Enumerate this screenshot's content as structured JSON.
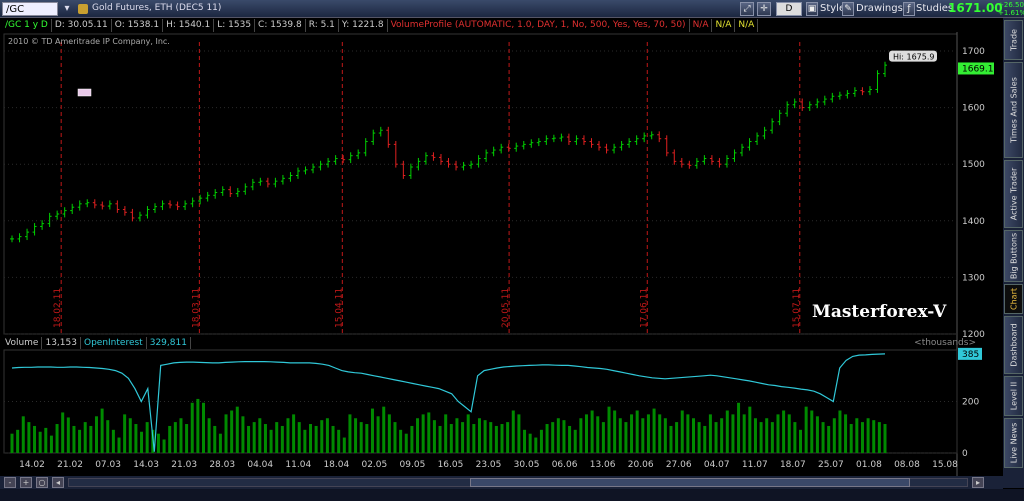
{
  "titlebar": {
    "symbol": "/GC",
    "description": "Gold Futures, ETH (DEC5 11)",
    "period_btn": "D",
    "style_label": "Style",
    "drawings_label": "Drawings",
    "studies_label": "Studies",
    "last_price": "1671.00",
    "net_change": "+26.50",
    "pct_change": "+1.61%"
  },
  "infobar": {
    "sym_period": "/GC 1 y D",
    "date": "D: 30.05.11",
    "open": "O: 1538.1",
    "high": "H: 1540.1",
    "low": "L: 1535",
    "close": "C: 1539.8",
    "range": "R: 5.1",
    "y": "Y: 1221.8",
    "study": "VolumeProfile (AUTOMATIC, 1.0, DAY, 1, No, 500, Yes, Yes, 70, 50)",
    "na1": "N/A",
    "na2": "N/A",
    "na3": "N/A"
  },
  "copyright": "2010 © TD Ameritrade IP Company, Inc.",
  "watermark": "Masterforex-V",
  "price_axis": {
    "ticks": [
      "1700",
      "1600",
      "1500",
      "1400",
      "1300",
      "1200"
    ],
    "last_label": "1669.1",
    "hi_label": "Hi: 1675.9"
  },
  "vertical_markers": [
    "18.02.11",
    "18.03.11",
    "15.04.11",
    "20.05.11",
    "17.06.11",
    "15.07.11"
  ],
  "lower_panel": {
    "volume_label": "Volume",
    "volume_value": "13,153",
    "oi_label": "OpenInterest",
    "oi_value": "329,811",
    "units": "<thousands>",
    "axis_ticks": [
      "200",
      "0"
    ],
    "oi_last": "385"
  },
  "x_axis_dates": [
    "14.02",
    "21.02",
    "07.03",
    "14.03",
    "21.03",
    "28.03",
    "04.04",
    "11.04",
    "18.04",
    "02.05",
    "09.05",
    "16.05",
    "23.05",
    "30.05",
    "06.06",
    "13.06",
    "20.06",
    "27.06",
    "04.07",
    "11.07",
    "18.07",
    "25.07",
    "01.08",
    "08.08",
    "15.08"
  ],
  "side_tabs": [
    "Trade",
    "Times And Sales",
    "Active Trader",
    "Big Buttons",
    "Chart",
    "Dashboard",
    "Level II",
    "Live News"
  ],
  "colors": {
    "up_bar": "#00d000",
    "down_bar": "#e02020",
    "volume": "#008a00",
    "open_interest": "#30c8d8",
    "marker": "#c01818",
    "last_price": "#33ee33"
  },
  "chart_data": {
    "type": "line",
    "title": "",
    "price_ylim": [
      1200,
      1730
    ],
    "closes": [
      1368,
      1372,
      1380,
      1390,
      1395,
      1408,
      1412,
      1418,
      1424,
      1430,
      1432,
      1428,
      1426,
      1430,
      1420,
      1415,
      1405,
      1410,
      1420,
      1425,
      1430,
      1428,
      1425,
      1430,
      1435,
      1440,
      1445,
      1450,
      1455,
      1448,
      1452,
      1460,
      1468,
      1470,
      1465,
      1470,
      1475,
      1480,
      1488,
      1490,
      1495,
      1500,
      1505,
      1510,
      1508,
      1515,
      1520,
      1540,
      1555,
      1560,
      1535,
      1500,
      1480,
      1495,
      1505,
      1515,
      1512,
      1505,
      1500,
      1495,
      1498,
      1500,
      1510,
      1520,
      1525,
      1530,
      1528,
      1532,
      1535,
      1538,
      1540,
      1545,
      1546,
      1548,
      1540,
      1545,
      1540,
      1535,
      1530,
      1525,
      1530,
      1535,
      1540,
      1545,
      1550,
      1552,
      1545,
      1520,
      1505,
      1500,
      1498,
      1505,
      1510,
      1505,
      1500,
      1510,
      1520,
      1530,
      1540,
      1550,
      1560,
      1575,
      1590,
      1605,
      1610,
      1600,
      1605,
      1610,
      1615,
      1620,
      1622,
      1625,
      1630,
      1628,
      1632,
      1660,
      1675
    ],
    "open_interest": [
      330,
      332,
      333,
      333,
      334,
      334,
      334,
      333,
      333,
      334,
      334,
      333,
      332,
      330,
      328,
      325,
      320,
      310,
      290,
      250,
      200,
      250,
      5,
      340,
      345,
      350,
      352,
      353,
      353,
      352,
      351,
      350,
      350,
      352,
      353,
      354,
      355,
      355,
      355,
      355,
      354,
      353,
      352,
      350,
      350,
      350,
      350,
      348,
      345,
      340,
      330,
      320,
      315,
      312,
      310,
      305,
      300,
      295,
      290,
      285,
      280,
      275,
      270,
      265,
      260,
      255,
      250,
      240,
      230,
      200,
      180,
      160,
      300,
      320,
      325,
      330,
      334,
      336,
      338,
      339,
      340,
      341,
      342,
      342,
      341,
      340,
      340,
      338,
      335,
      332,
      330,
      328,
      325,
      320,
      315,
      310,
      305,
      300,
      296,
      292,
      290,
      288,
      290,
      292,
      294,
      296,
      298,
      300,
      302,
      300,
      296,
      292,
      288,
      284,
      280,
      275,
      270,
      265,
      262,
      258,
      255,
      252,
      248,
      245,
      240,
      230,
      215,
      200,
      330,
      360,
      375,
      380,
      381,
      383,
      384,
      385
    ],
    "volume": [
      50,
      60,
      95,
      80,
      70,
      55,
      65,
      45,
      75,
      105,
      92,
      70,
      60,
      80,
      70,
      95,
      115,
      85,
      60,
      40,
      100,
      90,
      75,
      55,
      80,
      60,
      50,
      35,
      70,
      80,
      90,
      75,
      130,
      140,
      130,
      90,
      70,
      50,
      100,
      110,
      120,
      95,
      70,
      80,
      90,
      75,
      60,
      80,
      70,
      90,
      100,
      80,
      60,
      75,
      70,
      85,
      90,
      70,
      60,
      40,
      100,
      90,
      80,
      75,
      115,
      95,
      120,
      100,
      80,
      60,
      50,
      70,
      90,
      100,
      105,
      85,
      70,
      100,
      75,
      90,
      80,
      100,
      75,
      90,
      85,
      80,
      70,
      75,
      80,
      110,
      100,
      60,
      50,
      40,
      60,
      75,
      80,
      90,
      85,
      70,
      60,
      90,
      100,
      110,
      95,
      80,
      120,
      110,
      90,
      80,
      100,
      110,
      90,
      100,
      115,
      100,
      90,
      70,
      80,
      110,
      100,
      90,
      80,
      70,
      100,
      80,
      90,
      110,
      100,
      130,
      100,
      120,
      90,
      80,
      90,
      80,
      100,
      110,
      100,
      80,
      60,
      120,
      110,
      95,
      80,
      70,
      90,
      110,
      100,
      75,
      90,
      80,
      90,
      85,
      80,
      75
    ]
  }
}
